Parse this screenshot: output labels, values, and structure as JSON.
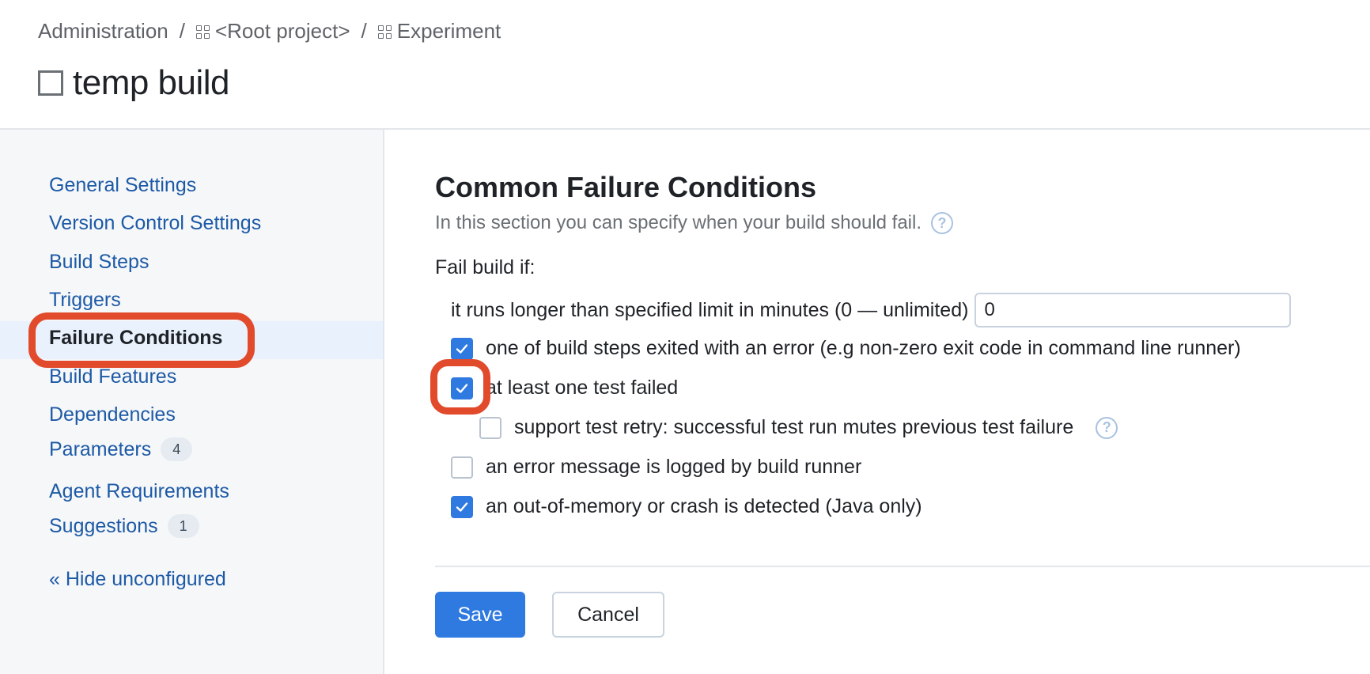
{
  "breadcrumb": {
    "items": [
      "Administration",
      "<Root project>",
      "Experiment"
    ],
    "separator": "/"
  },
  "page": {
    "title": "temp build"
  },
  "sidebar": {
    "items": [
      {
        "label": "General Settings"
      },
      {
        "label": "Version Control Settings"
      },
      {
        "label": "Build Steps"
      },
      {
        "label": "Triggers"
      },
      {
        "label": "Failure Conditions",
        "active": true
      },
      {
        "label": "Build Features"
      },
      {
        "label": "Dependencies"
      },
      {
        "label": "Parameters",
        "badge": "4"
      },
      {
        "label": "Agent Requirements"
      },
      {
        "label": "Suggestions",
        "badge": "1"
      }
    ],
    "hide_unconfigured": "« Hide unconfigured"
  },
  "main": {
    "section_title": "Common Failure Conditions",
    "section_desc": "In this section you can specify when your build should fail.",
    "help_glyph": "?",
    "fail_label": "Fail build if:",
    "timeout_label": "it runs longer than specified limit in minutes (0 — unlimited)",
    "timeout_value": "0",
    "conditions": [
      {
        "label": "one of build steps exited with an error (e.g non-zero exit code in command line runner)",
        "checked": true
      },
      {
        "label": "at least one test failed",
        "checked": true
      },
      {
        "label": "support test retry: successful test run mutes previous test failure",
        "checked": false
      },
      {
        "label": "an error message is logged by build runner",
        "checked": false
      },
      {
        "label": "an out-of-memory or crash is detected (Java only)",
        "checked": true
      }
    ],
    "save_label": "Save",
    "cancel_label": "Cancel"
  },
  "colors": {
    "accent": "#2f7ae0",
    "link": "#1d5aa6",
    "highlight": "#e24a2c"
  }
}
